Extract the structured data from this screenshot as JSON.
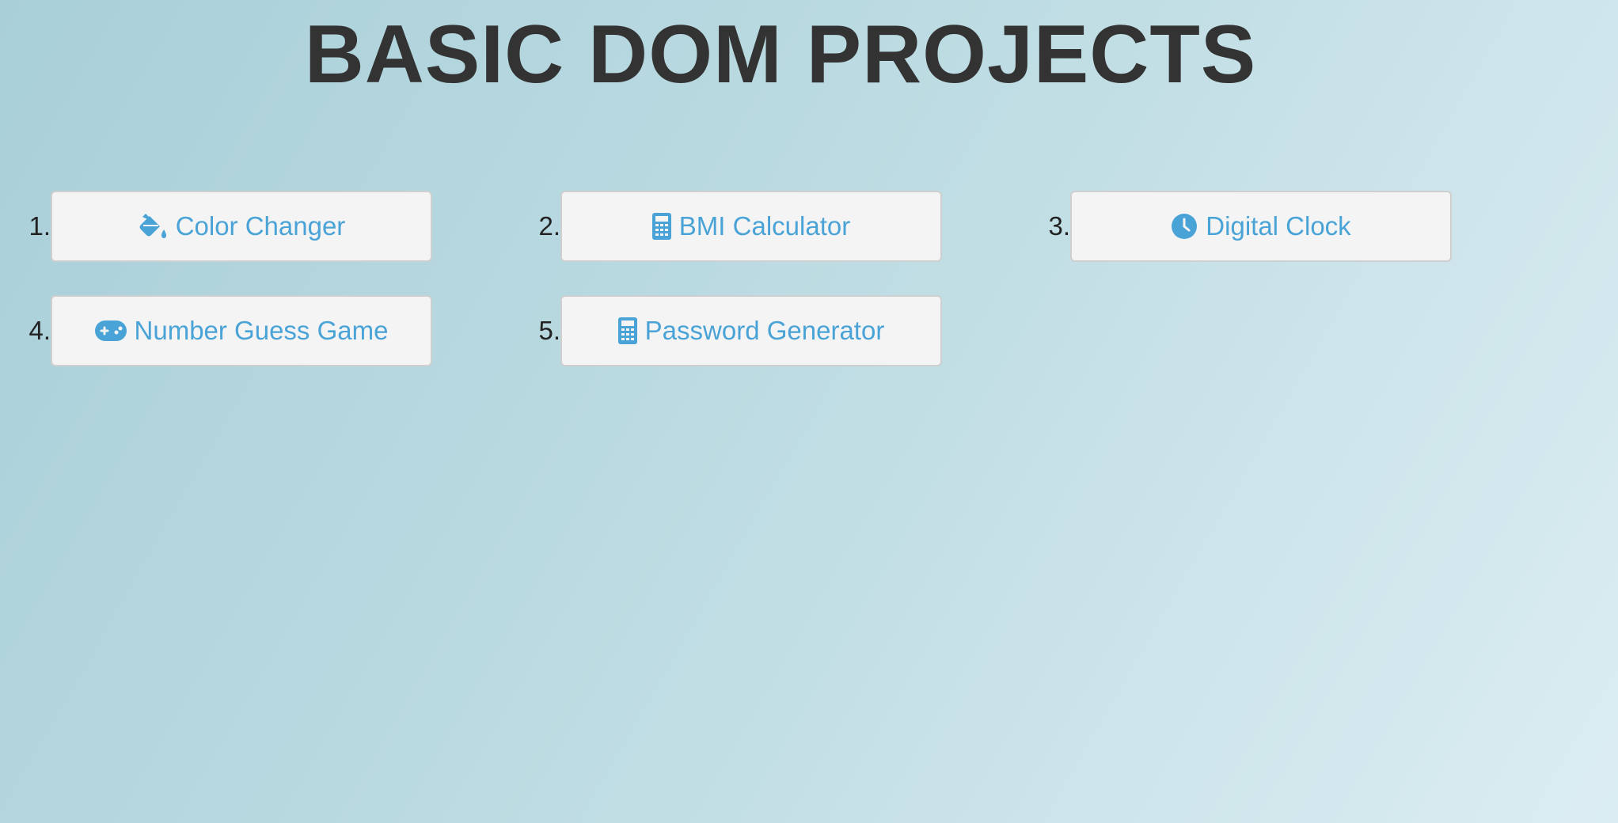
{
  "page": {
    "title": "BASIC DOM PROJECTS"
  },
  "colors": {
    "accent": "#4aa3d6",
    "title": "#333333",
    "button_bg": "#f4f4f4",
    "button_border": "#cfcfcf"
  },
  "projects": [
    {
      "number": "1.",
      "label": "Color Changer",
      "icon": "paint-bucket-icon"
    },
    {
      "number": "2.",
      "label": "BMI Calculator",
      "icon": "calculator-icon"
    },
    {
      "number": "3.",
      "label": "Digital Clock",
      "icon": "clock-icon"
    },
    {
      "number": "4.",
      "label": "Number Guess Game",
      "icon": "gamepad-icon"
    },
    {
      "number": "5.",
      "label": "Password Generator",
      "icon": "calculator-icon"
    }
  ]
}
